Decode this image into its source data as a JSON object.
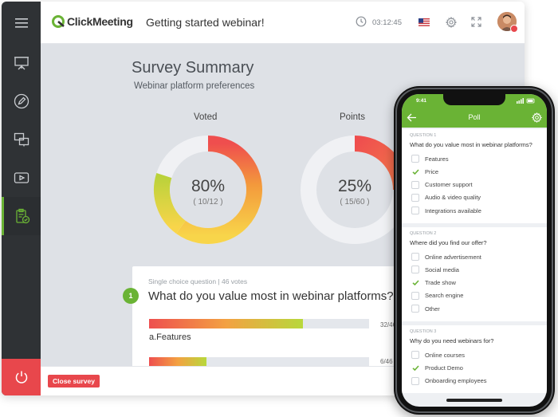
{
  "header": {
    "brand": "ClickMeeting",
    "webinar_title": "Getting started webinar!",
    "timer": "03:12:45"
  },
  "sidebar": {
    "items": [
      {
        "icon": "menu-icon"
      },
      {
        "icon": "presentation-icon"
      },
      {
        "icon": "pencil-icon"
      },
      {
        "icon": "screen-share-icon"
      },
      {
        "icon": "video-play-icon"
      },
      {
        "icon": "clipboard-check-icon",
        "active": true
      },
      {
        "icon": "power-icon"
      }
    ]
  },
  "summary": {
    "title": "Survey Summary",
    "subtitle": "Webinar platform preferences",
    "voted": {
      "label": "Voted",
      "percent": "80%",
      "fraction": "( 10/12 )",
      "value": 0.8
    },
    "points": {
      "label": "Points",
      "percent": "25%",
      "fraction": "( 15/60 )",
      "value": 0.25
    }
  },
  "question_card": {
    "meta": "Single choice question  |  46 votes",
    "number": "1",
    "question": "What do you value most in webinar platforms?",
    "answers": [
      {
        "label": "a.Features",
        "count": "32/46",
        "fraction": 0.7
      },
      {
        "label": "",
        "count": "6/46",
        "fraction": 0.26
      }
    ]
  },
  "footer": {
    "close_label": "Close survey"
  },
  "colors": {
    "accent": "#6ab335",
    "danger": "#e8474c",
    "sidebar": "#2f3235"
  },
  "phone": {
    "status_time": "9:41",
    "title": "Poll",
    "questions": [
      {
        "header": "QUESTION 1",
        "text": "What do you value most in webinar platforms?",
        "options": [
          {
            "label": "Features",
            "checked": false
          },
          {
            "label": "Price",
            "checked": true
          },
          {
            "label": "Customer support",
            "checked": false
          },
          {
            "label": "Audio & video quality",
            "checked": false
          },
          {
            "label": "Integrations available",
            "checked": false
          }
        ]
      },
      {
        "header": "QUESTION 2",
        "text": "Where did you find our offer?",
        "options": [
          {
            "label": "Online advertisement",
            "checked": false
          },
          {
            "label": "Social media",
            "checked": false
          },
          {
            "label": "Trade show",
            "checked": true
          },
          {
            "label": "Search engine",
            "checked": false
          },
          {
            "label": "Other",
            "checked": false
          }
        ]
      },
      {
        "header": "QUESTION 3",
        "text": "Why do you need webinars for?",
        "options": [
          {
            "label": "Online courses",
            "checked": false
          },
          {
            "label": "Product Demo",
            "checked": true
          },
          {
            "label": "Onboarding employees",
            "checked": false
          }
        ]
      }
    ]
  }
}
